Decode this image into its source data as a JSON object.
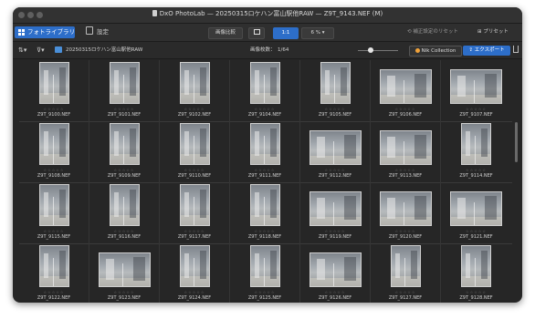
{
  "window": {
    "title": "DxO PhotoLab — 20250315ロケハン富山駅他RAW — Z9T_9143.NEF (M)"
  },
  "toolbar": {
    "library_tab": "フォトライブラリ",
    "settings_tab": "設定",
    "compare_button": "画像比較",
    "zoom_1to1": "1:1",
    "zoom_percent": "6 %",
    "reset_button": "補正設定のリセット",
    "preset_button": "プリセット"
  },
  "subbar": {
    "sort_icon": "sort-icon",
    "filter_icon": "filter-icon",
    "folder_name": "20250315ロケハン富山駅他RAW",
    "image_count_label": "画像枚数：",
    "image_count": "1/64",
    "nik_button": "Nik Collection",
    "export_button": "エクスポート"
  },
  "thumbnails": {
    "rating": "☆☆☆☆☆",
    "rows": [
      {
        "items": [
          {
            "name": "Z9T_9100.NEF",
            "orientation": "portrait"
          },
          {
            "name": "Z9T_9101.NEF",
            "orientation": "portrait"
          },
          {
            "name": "Z9T_9102.NEF",
            "orientation": "portrait"
          },
          {
            "name": "Z9T_9104.NEF",
            "orientation": "portrait"
          },
          {
            "name": "Z9T_9105.NEF",
            "orientation": "portrait"
          },
          {
            "name": "Z9T_9106.NEF",
            "orientation": "landscape"
          },
          {
            "name": "Z9T_9107.NEF",
            "orientation": "landscape"
          }
        ]
      },
      {
        "items": [
          {
            "name": "Z9T_9108.NEF",
            "orientation": "portrait"
          },
          {
            "name": "Z9T_9109.NEF",
            "orientation": "portrait"
          },
          {
            "name": "Z9T_9110.NEF",
            "orientation": "portrait"
          },
          {
            "name": "Z9T_9111.NEF",
            "orientation": "portrait"
          },
          {
            "name": "Z9T_9112.NEF",
            "orientation": "landscape"
          },
          {
            "name": "Z9T_9113.NEF",
            "orientation": "landscape"
          },
          {
            "name": "Z9T_9114.NEF",
            "orientation": "portrait"
          }
        ]
      },
      {
        "items": [
          {
            "name": "Z9T_9115.NEF",
            "orientation": "portrait"
          },
          {
            "name": "Z9T_9116.NEF",
            "orientation": "portrait"
          },
          {
            "name": "Z9T_9117.NEF",
            "orientation": "portrait"
          },
          {
            "name": "Z9T_9118.NEF",
            "orientation": "portrait"
          },
          {
            "name": "Z9T_9119.NEF",
            "orientation": "landscape"
          },
          {
            "name": "Z9T_9120.NEF",
            "orientation": "landscape"
          },
          {
            "name": "Z9T_9121.NEF",
            "orientation": "landscape"
          }
        ]
      },
      {
        "items": [
          {
            "name": "Z9T_9122.NEF",
            "orientation": "portrait"
          },
          {
            "name": "Z9T_9123.NEF",
            "orientation": "landscape"
          },
          {
            "name": "Z9T_9124.NEF",
            "orientation": "portrait"
          },
          {
            "name": "Z9T_9125.NEF",
            "orientation": "portrait"
          },
          {
            "name": "Z9T_9126.NEF",
            "orientation": "landscape"
          },
          {
            "name": "Z9T_9127.NEF",
            "orientation": "portrait"
          },
          {
            "name": "Z9T_9128.NEF",
            "orientation": "portrait"
          }
        ]
      }
    ]
  },
  "colors": {
    "accent": "#2d6ec9",
    "background": "#262626",
    "nik_dot": "#f0a23a"
  }
}
